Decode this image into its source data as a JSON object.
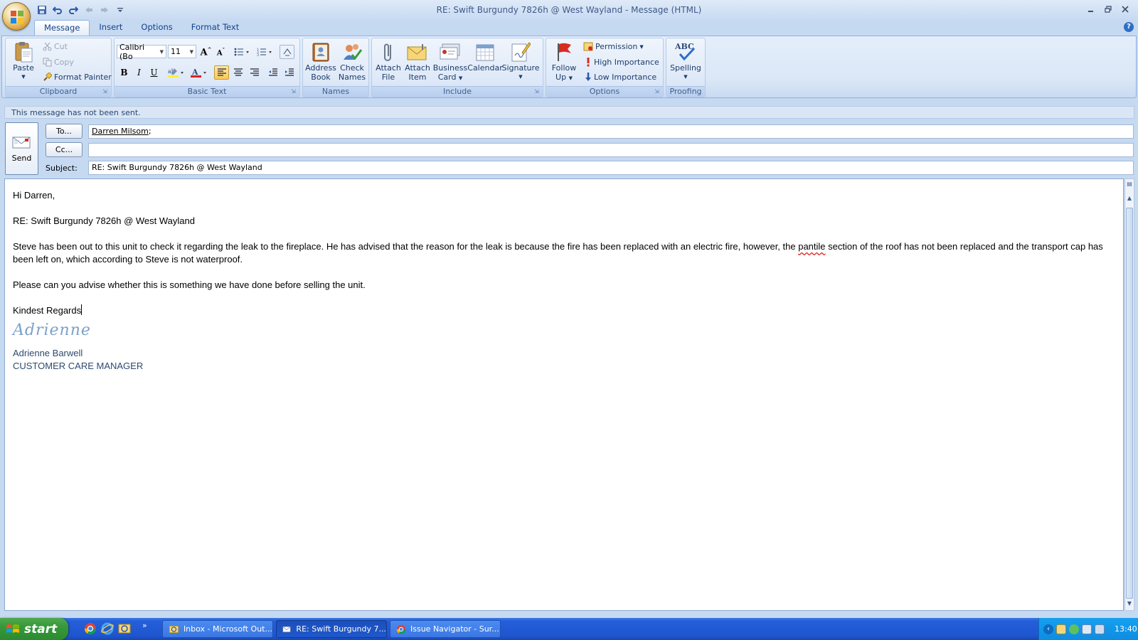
{
  "window": {
    "title": "RE: Swift Burgundy 7826h @ West Wayland - Message (HTML)"
  },
  "tabs": [
    {
      "label": "Message",
      "active": true
    },
    {
      "label": "Insert",
      "active": false
    },
    {
      "label": "Options",
      "active": false
    },
    {
      "label": "Format Text",
      "active": false
    }
  ],
  "ribbon": {
    "clipboard": {
      "label": "Clipboard",
      "paste": "Paste",
      "cut": "Cut",
      "copy": "Copy",
      "format_painter": "Format Painter"
    },
    "basic_text": {
      "label": "Basic Text",
      "font": "Calibri (Bo",
      "size": "11",
      "bold": "B",
      "italic": "I",
      "underline": "U"
    },
    "names": {
      "label": "Names",
      "address_book_1": "Address",
      "address_book_2": "Book",
      "check_names_1": "Check",
      "check_names_2": "Names"
    },
    "include": {
      "label": "Include",
      "attach_file_1": "Attach",
      "attach_file_2": "File",
      "attach_item_1": "Attach",
      "attach_item_2": "Item",
      "business_card_1": "Business",
      "business_card_2": "Card",
      "calendar": "Calendar",
      "signature": "Signature"
    },
    "options": {
      "label": "Options",
      "follow_up_1": "Follow",
      "follow_up_2": "Up",
      "permission": "Permission",
      "high_importance": "High Importance",
      "low_importance": "Low Importance"
    },
    "proofing": {
      "label": "Proofing",
      "spelling": "Spelling",
      "abc": "ABC"
    }
  },
  "message": {
    "info": "This message has not been sent.",
    "send": "Send",
    "to_button": "To...",
    "cc_button": "Cc...",
    "subject_label": "Subject:",
    "to_value": "Darren Milsom",
    "to_sep": ";",
    "cc_value": "",
    "subject_value": "RE: Swift Burgundy 7826h @ West Wayland"
  },
  "body": {
    "greeting": "Hi Darren,",
    "subject_line": "RE: Swift Burgundy 7826h @ West Wayland",
    "para1_a": "Steve has been out to this unit to check it regarding the leak to the fireplace.  He has advised that the reason for the leak is because the fire has been replaced with an electric fire, however, the ",
    "para1_misspelled": "pantile",
    "para1_b": " section of the roof has not been replaced and the transport cap has been left on, which according to Steve is not waterproof.",
    "para2": "Please can you advise whether  this is something we have done before selling the unit.",
    "closing": "Kindest Regards",
    "signature_script": "Adrienne",
    "sig_name": "Adrienne Barwell",
    "sig_title": "CUSTOMER CARE MANAGER"
  },
  "taskbar": {
    "start": "start",
    "more": "»",
    "tasks": [
      {
        "label": "Inbox - Microsoft Out..."
      },
      {
        "label": "RE: Swift Burgundy 7..."
      },
      {
        "label": "Issue Navigator - Sur..."
      }
    ],
    "clock": "13:40"
  }
}
